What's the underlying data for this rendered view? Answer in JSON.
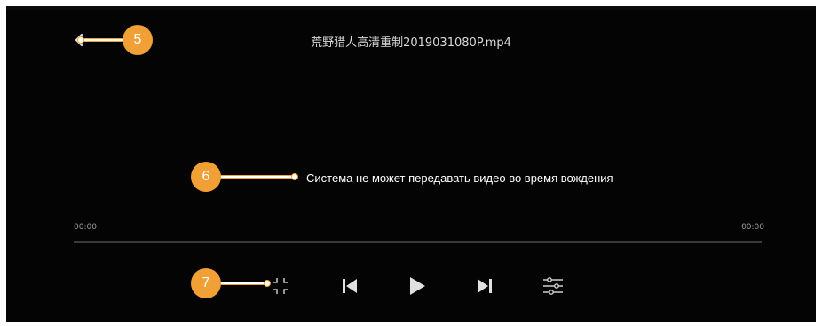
{
  "player": {
    "title": "荒野猎人高清重制2019031080P.mp4",
    "message": "Система не может передавать видео во время вождения",
    "time_current": "00:00",
    "time_total": "00:00",
    "progress": 0
  },
  "controls": {
    "icons": [
      "back-icon",
      "exit-fullscreen-icon",
      "previous-icon",
      "play-icon",
      "next-icon",
      "settings-sliders-icon"
    ]
  },
  "annotations": {
    "labels": [
      "5",
      "6",
      "7"
    ],
    "accent_color": "#f0a035"
  }
}
